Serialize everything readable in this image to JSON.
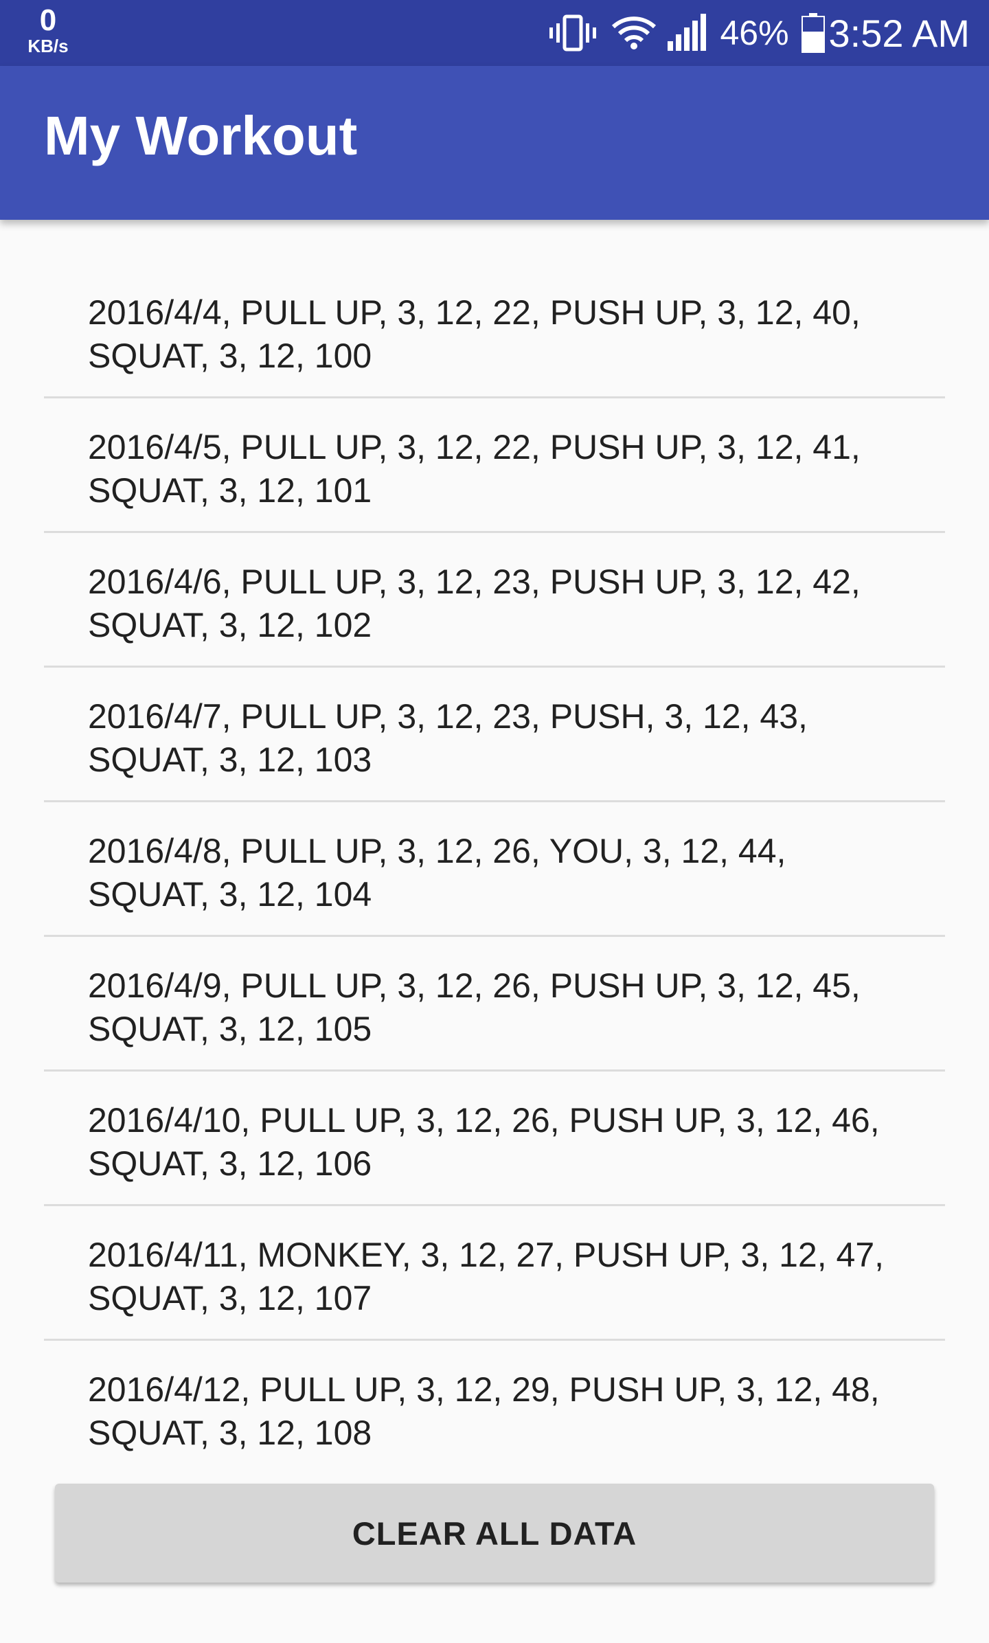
{
  "status_bar": {
    "net_speed_value": "0",
    "net_speed_unit": "KB/s",
    "battery_percent": "46%",
    "time": "3:52 AM",
    "icons": [
      "vibrate-icon",
      "wifi-icon",
      "signal-icon",
      "battery-icon"
    ]
  },
  "app_bar": {
    "title": "My Workout",
    "color": "#3f51b5",
    "status_color": "#303f9f"
  },
  "workouts": [
    {
      "line1": "2016/4/4, PULL UP, 3, 12, 22, PUSH UP, 3, 12, 40,",
      "line2": "SQUAT, 3, 12, 100"
    },
    {
      "line1": "2016/4/5, PULL UP, 3, 12, 22, PUSH UP, 3, 12, 41,",
      "line2": "SQUAT, 3, 12, 101"
    },
    {
      "line1": "2016/4/6, PULL UP, 3, 12, 23, PUSH UP, 3, 12, 42,",
      "line2": "SQUAT, 3, 12, 102"
    },
    {
      "line1": "2016/4/7, PULL UP, 3, 12, 23, PUSH, 3, 12, 43,",
      "line2": "SQUAT, 3, 12, 103"
    },
    {
      "line1": "2016/4/8, PULL UP, 3, 12, 26, YOU, 3, 12, 44,",
      "line2": "SQUAT, 3, 12, 104"
    },
    {
      "line1": "2016/4/9, PULL UP, 3, 12, 26, PUSH UP, 3, 12, 45,",
      "line2": "SQUAT, 3, 12, 105"
    },
    {
      "line1": "2016/4/10, PULL UP, 3, 12, 26, PUSH UP, 3, 12, 46,",
      "line2": "SQUAT, 3, 12, 106"
    },
    {
      "line1": "2016/4/11, MONKEY, 3, 12, 27, PUSH UP, 3, 12, 47,",
      "line2": "SQUAT, 3, 12, 107"
    },
    {
      "line1": "2016/4/12, PULL UP, 3, 12, 29, PUSH UP, 3, 12, 48,",
      "line2": "SQUAT, 3, 12, 108"
    }
  ],
  "actions": {
    "clear_label": "CLEAR ALL DATA"
  }
}
